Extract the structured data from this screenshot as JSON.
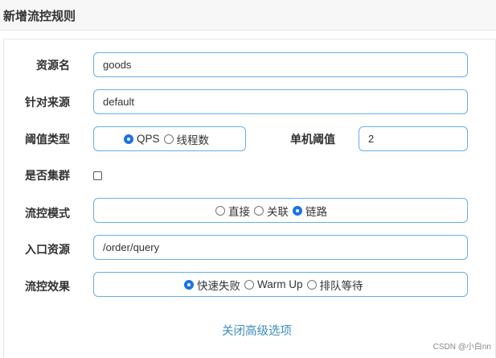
{
  "dialog": {
    "title": "新增流控规则"
  },
  "form": {
    "resource_name": {
      "label": "资源名",
      "value": "goods"
    },
    "limit_app": {
      "label": "针对来源",
      "value": "default"
    },
    "threshold_type": {
      "label": "阈值类型",
      "options": [
        "QPS",
        "线程数"
      ],
      "selected": "QPS"
    },
    "single_threshold": {
      "label": "单机阈值",
      "value": "2"
    },
    "cluster_mode": {
      "label": "是否集群",
      "checked": false
    },
    "strategy": {
      "label": "流控模式",
      "options": [
        "直接",
        "关联",
        "链路"
      ],
      "selected": "链路"
    },
    "ref_resource": {
      "label": "入口资源",
      "value": "/order/query"
    },
    "control_behavior": {
      "label": "流控效果",
      "options": [
        "快速失败",
        "Warm Up",
        "排队等待"
      ],
      "selected": "快速失败"
    }
  },
  "advanced_toggle": {
    "label": "关闭高级选项"
  },
  "watermark": {
    "text": "CSDN @小白nn"
  },
  "colors": {
    "accent": "#1a73e8",
    "input_border": "#66afe9",
    "link": "#3c8dbc"
  }
}
